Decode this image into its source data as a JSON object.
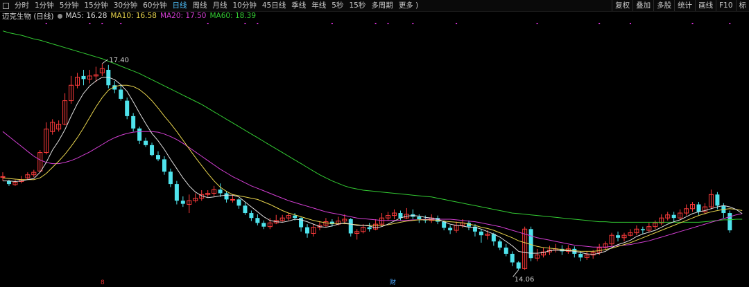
{
  "toolbar": {
    "periods": [
      "分时",
      "1分钟",
      "5分钟",
      "15分钟",
      "30分钟",
      "60分钟",
      "日线",
      "周线",
      "月线",
      "10分钟",
      "45日线",
      "季线",
      "年线",
      "5秒",
      "15秒",
      "多周期",
      "更多 )"
    ],
    "active_period": "日线",
    "right_items": [
      "复权",
      "叠加",
      "多股",
      "统计",
      "画线",
      "F10",
      "标"
    ]
  },
  "stock": {
    "name": "迈克生物 (日线)"
  },
  "ma_legend": [
    {
      "label": "MA5: 16.28",
      "color": "#e0e0e0"
    },
    {
      "label": "MA10: 16.58",
      "color": "#e8d44d"
    },
    {
      "label": "MA20: 17.50",
      "color": "#d43fd4"
    },
    {
      "label": "MA60: 18.39",
      "color": "#33cc33"
    }
  ],
  "annotations": {
    "high": "17.40",
    "low": "14.06"
  },
  "markers": {
    "bottom_left": "8",
    "bottom_mid": "财"
  },
  "chart_data": {
    "type": "candlestick",
    "colors": {
      "up": "#ff3b3b",
      "down": "#4fe3ec",
      "ma5": "#e0e0e0",
      "ma10": "#e8d44d",
      "ma20": "#d43fd4",
      "ma60": "#33cc33"
    },
    "candles": [
      [
        15.56,
        15.57,
        15.64,
        15.5
      ],
      [
        15.5,
        15.45,
        15.52,
        15.42
      ],
      [
        15.44,
        15.48,
        15.52,
        15.42
      ],
      [
        15.49,
        15.52,
        15.58,
        15.46
      ],
      [
        15.55,
        15.6,
        15.64,
        15.52
      ],
      [
        15.6,
        15.64,
        15.68,
        15.56
      ],
      [
        15.66,
        15.96,
        16.0,
        15.64
      ],
      [
        15.96,
        16.34,
        16.45,
        15.93
      ],
      [
        16.3,
        16.45,
        16.5,
        16.25
      ],
      [
        16.34,
        16.42,
        16.48,
        16.3
      ],
      [
        16.42,
        16.8,
        16.92,
        16.4
      ],
      [
        16.8,
        17.05,
        17.2,
        16.75
      ],
      [
        17.05,
        17.18,
        17.25,
        17.0
      ],
      [
        17.2,
        17.15,
        17.3,
        17.05
      ],
      [
        17.15,
        17.2,
        17.3,
        17.08
      ],
      [
        17.2,
        17.22,
        17.35,
        17.1
      ],
      [
        17.25,
        17.32,
        17.4,
        17.2
      ],
      [
        17.3,
        17.05,
        17.38,
        17.0
      ],
      [
        17.05,
        16.98,
        17.12,
        16.92
      ],
      [
        16.98,
        16.83,
        17.05,
        16.8
      ],
      [
        16.8,
        16.55,
        16.85,
        16.5
      ],
      [
        16.55,
        16.35,
        16.6,
        16.3
      ],
      [
        16.35,
        16.15,
        16.38,
        16.1
      ],
      [
        16.15,
        16.08,
        16.2,
        16.05
      ],
      [
        16.08,
        15.92,
        16.12,
        15.9
      ],
      [
        15.92,
        15.85,
        15.98,
        15.82
      ],
      [
        15.85,
        15.65,
        15.9,
        15.6
      ],
      [
        15.65,
        15.45,
        15.7,
        15.4
      ],
      [
        15.45,
        15.18,
        15.5,
        15.12
      ],
      [
        15.18,
        15.13,
        15.25,
        15.08
      ],
      [
        15.12,
        15.18,
        15.28,
        14.98
      ],
      [
        15.18,
        15.22,
        15.3,
        15.15
      ],
      [
        15.22,
        15.28,
        15.35,
        15.18
      ],
      [
        15.28,
        15.3,
        15.35,
        15.24
      ],
      [
        15.3,
        15.36,
        15.42,
        15.25
      ],
      [
        15.36,
        15.3,
        15.46,
        15.24
      ],
      [
        15.3,
        15.2,
        15.34,
        15.15
      ],
      [
        15.2,
        15.2,
        15.28,
        15.15
      ],
      [
        15.2,
        15.1,
        15.22,
        15.05
      ],
      [
        15.1,
        14.98,
        15.15,
        14.95
      ],
      [
        14.98,
        14.9,
        15.02,
        14.85
      ],
      [
        14.9,
        14.82,
        14.96,
        14.78
      ],
      [
        14.82,
        14.76,
        14.86,
        14.72
      ],
      [
        14.76,
        14.82,
        14.9,
        14.72
      ],
      [
        14.82,
        14.86,
        14.95,
        14.8
      ],
      [
        14.86,
        14.9,
        14.95,
        14.84
      ],
      [
        14.9,
        14.94,
        14.98,
        14.86
      ],
      [
        14.94,
        14.9,
        14.98,
        14.86
      ],
      [
        14.9,
        14.75,
        14.92,
        14.68
      ],
      [
        14.75,
        14.65,
        14.8,
        14.58
      ],
      [
        14.65,
        14.75,
        14.8,
        14.6
      ],
      [
        14.75,
        14.78,
        14.85,
        14.7
      ],
      [
        14.78,
        14.84,
        14.9,
        14.75
      ],
      [
        14.84,
        14.8,
        14.88,
        14.76
      ],
      [
        14.8,
        14.85,
        14.92,
        14.78
      ],
      [
        14.85,
        14.88,
        14.96,
        14.8
      ],
      [
        14.88,
        14.65,
        14.9,
        14.6
      ],
      [
        14.65,
        14.68,
        14.72,
        14.55
      ],
      [
        14.68,
        14.75,
        14.8,
        14.65
      ],
      [
        14.75,
        14.72,
        14.82,
        14.68
      ],
      [
        14.72,
        14.8,
        14.88,
        14.7
      ],
      [
        14.8,
        14.9,
        14.98,
        14.76
      ],
      [
        14.9,
        14.94,
        15.0,
        14.85
      ],
      [
        14.94,
        14.98,
        15.04,
        14.88
      ],
      [
        14.98,
        14.9,
        15.02,
        14.86
      ],
      [
        14.9,
        14.96,
        15.06,
        14.88
      ],
      [
        14.96,
        14.92,
        15.04,
        14.88
      ],
      [
        14.92,
        14.88,
        14.96,
        14.82
      ],
      [
        14.88,
        14.86,
        14.94,
        14.82
      ],
      [
        14.86,
        14.9,
        14.96,
        14.82
      ],
      [
        14.9,
        14.84,
        14.94,
        14.8
      ],
      [
        14.84,
        14.74,
        14.86,
        14.7
      ],
      [
        14.74,
        14.7,
        14.78,
        14.64
      ],
      [
        14.7,
        14.78,
        14.84,
        14.66
      ],
      [
        14.78,
        14.82,
        14.88,
        14.74
      ],
      [
        14.82,
        14.76,
        14.86,
        14.7
      ],
      [
        14.76,
        14.68,
        14.8,
        14.6
      ],
      [
        14.68,
        14.62,
        14.72,
        14.5
      ],
      [
        14.62,
        14.64,
        14.7,
        14.55
      ],
      [
        14.64,
        14.52,
        14.66,
        14.45
      ],
      [
        14.52,
        14.42,
        14.55,
        14.38
      ],
      [
        14.42,
        14.32,
        14.48,
        14.28
      ],
      [
        14.32,
        14.18,
        14.36,
        14.12
      ],
      [
        14.18,
        14.08,
        14.2,
        14.06
      ],
      [
        14.08,
        14.72,
        14.76,
        14.06
      ],
      [
        14.72,
        14.25,
        14.76,
        14.2
      ],
      [
        14.25,
        14.3,
        14.4,
        14.2
      ],
      [
        14.3,
        14.35,
        14.42,
        14.26
      ],
      [
        14.35,
        14.38,
        14.45,
        14.3
      ],
      [
        14.38,
        14.4,
        14.48,
        14.34
      ],
      [
        14.4,
        14.36,
        14.46,
        14.3
      ],
      [
        14.36,
        14.4,
        14.46,
        14.32
      ],
      [
        14.4,
        14.32,
        14.44,
        14.26
      ],
      [
        14.32,
        14.26,
        14.36,
        14.2
      ],
      [
        14.26,
        14.3,
        14.36,
        14.22
      ],
      [
        14.3,
        14.34,
        14.38,
        14.24
      ],
      [
        14.34,
        14.42,
        14.48,
        14.3
      ],
      [
        14.42,
        14.48,
        14.52,
        14.38
      ],
      [
        14.48,
        14.62,
        14.66,
        14.44
      ],
      [
        14.62,
        14.58,
        14.68,
        14.52
      ],
      [
        14.58,
        14.62,
        14.66,
        14.52
      ],
      [
        14.62,
        14.66,
        14.72,
        14.6
      ],
      [
        14.66,
        14.72,
        14.78,
        14.62
      ],
      [
        14.72,
        14.7,
        14.76,
        14.64
      ],
      [
        14.7,
        14.76,
        14.82,
        14.66
      ],
      [
        14.76,
        14.82,
        14.86,
        14.72
      ],
      [
        14.82,
        14.9,
        14.96,
        14.78
      ],
      [
        14.9,
        14.95,
        15.0,
        14.86
      ],
      [
        14.95,
        14.9,
        15.0,
        14.84
      ],
      [
        14.9,
        14.98,
        15.04,
        14.88
      ],
      [
        14.98,
        15.05,
        15.12,
        14.94
      ],
      [
        15.05,
        15.12,
        15.16,
        15.0
      ],
      [
        15.12,
        15.0,
        15.16,
        14.95
      ],
      [
        15.0,
        15.08,
        15.14,
        14.96
      ],
      [
        15.08,
        15.28,
        15.36,
        15.04
      ],
      [
        15.28,
        15.1,
        15.32,
        15.04
      ],
      [
        15.1,
        14.98,
        15.14,
        14.9
      ],
      [
        14.98,
        14.7,
        15.02,
        14.66
      ]
    ],
    "ma5": [
      15.5,
      15.5,
      15.49,
      15.5,
      15.52,
      15.54,
      15.64,
      15.8,
      16.0,
      16.15,
      16.33,
      16.55,
      16.75,
      16.92,
      17.04,
      17.12,
      17.18,
      17.18,
      17.14,
      17.06,
      16.95,
      16.78,
      16.6,
      16.43,
      16.27,
      16.15,
      16.01,
      15.85,
      15.7,
      15.55,
      15.42,
      15.32,
      15.26,
      15.23,
      15.24,
      15.26,
      15.27,
      15.27,
      15.24,
      15.16,
      15.08,
      15.0,
      14.92,
      14.86,
      14.84,
      14.83,
      14.85,
      14.88,
      14.87,
      14.84,
      14.8,
      14.76,
      14.75,
      14.77,
      14.8,
      14.82,
      14.8,
      14.78,
      14.78,
      14.77,
      14.74,
      14.76,
      14.8,
      14.85,
      14.9,
      14.93,
      14.94,
      14.93,
      14.91,
      14.9,
      14.88,
      14.84,
      14.8,
      14.78,
      14.77,
      14.75,
      14.75,
      14.72,
      14.68,
      14.64,
      14.59,
      14.52,
      14.45,
      14.36,
      14.34,
      14.33,
      14.33,
      14.34,
      14.37,
      14.38,
      14.37,
      14.37,
      14.36,
      14.34,
      14.32,
      14.31,
      14.33,
      14.36,
      14.42,
      14.47,
      14.5,
      14.54,
      14.6,
      14.64,
      14.67,
      14.7,
      14.75,
      14.8,
      14.84,
      14.87,
      14.92,
      14.97,
      15.0,
      15.02,
      15.05,
      15.08,
      15.1,
      15.08,
      15.04,
      14.97
    ],
    "ma10": [
      15.55,
      15.54,
      15.53,
      15.52,
      15.52,
      15.52,
      15.55,
      15.62,
      15.72,
      15.82,
      15.93,
      16.06,
      16.2,
      16.36,
      16.53,
      16.7,
      16.85,
      16.97,
      17.03,
      17.05,
      17.05,
      17.03,
      16.98,
      16.9,
      16.8,
      16.68,
      16.55,
      16.43,
      16.3,
      16.16,
      16.02,
      15.88,
      15.75,
      15.62,
      15.5,
      15.4,
      15.33,
      15.28,
      15.26,
      15.24,
      15.22,
      15.2,
      15.16,
      15.12,
      15.07,
      15.02,
      14.98,
      14.95,
      14.92,
      14.89,
      14.86,
      14.84,
      14.82,
      14.81,
      14.81,
      14.81,
      14.8,
      14.79,
      14.78,
      14.78,
      14.78,
      14.78,
      14.79,
      14.81,
      14.83,
      14.85,
      14.86,
      14.87,
      14.87,
      14.87,
      14.86,
      14.85,
      14.84,
      14.83,
      14.82,
      14.8,
      14.78,
      14.75,
      14.73,
      14.7,
      14.66,
      14.62,
      14.58,
      14.53,
      14.5,
      14.47,
      14.44,
      14.42,
      14.41,
      14.4,
      14.39,
      14.38,
      14.37,
      14.36,
      14.36,
      14.36,
      14.37,
      14.39,
      14.41,
      14.44,
      14.47,
      14.5,
      14.54,
      14.58,
      14.62,
      14.66,
      14.7,
      14.74,
      14.78,
      14.82,
      14.86,
      14.9,
      14.94,
      14.97,
      15.0,
      15.02,
      15.04,
      15.05,
      15.04,
      15.02
    ],
    "ma20": [
      16.3,
      16.22,
      16.14,
      16.06,
      15.98,
      15.9,
      15.84,
      15.8,
      15.78,
      15.78,
      15.8,
      15.83,
      15.87,
      15.92,
      15.97,
      16.03,
      16.09,
      16.15,
      16.2,
      16.24,
      16.27,
      16.29,
      16.3,
      16.3,
      16.3,
      16.29,
      16.26,
      16.22,
      16.17,
      16.11,
      16.04,
      15.97,
      15.9,
      15.83,
      15.76,
      15.69,
      15.63,
      15.57,
      15.52,
      15.47,
      15.42,
      15.38,
      15.34,
      15.3,
      15.26,
      15.22,
      15.18,
      15.15,
      15.12,
      15.09,
      15.06,
      15.03,
      15.0,
      14.98,
      14.96,
      14.94,
      14.92,
      14.9,
      14.89,
      14.88,
      14.87,
      14.86,
      14.86,
      14.86,
      14.86,
      14.86,
      14.87,
      14.87,
      14.88,
      14.88,
      14.88,
      14.88,
      14.88,
      14.87,
      14.86,
      14.85,
      14.84,
      14.82,
      14.8,
      14.78,
      14.76,
      14.73,
      14.7,
      14.67,
      14.64,
      14.61,
      14.58,
      14.56,
      14.54,
      14.52,
      14.5,
      14.48,
      14.46,
      14.45,
      14.44,
      14.43,
      14.43,
      14.43,
      14.44,
      14.45,
      14.46,
      14.47,
      14.49,
      14.51,
      14.53,
      14.56,
      14.59,
      14.62,
      14.65,
      14.68,
      14.71,
      14.74,
      14.77,
      14.8,
      14.83,
      14.86,
      14.89,
      14.92,
      14.95,
      14.97
    ],
    "ma60": [
      17.93,
      17.9,
      17.88,
      17.86,
      17.83,
      17.8,
      17.78,
      17.75,
      17.72,
      17.69,
      17.66,
      17.63,
      17.6,
      17.57,
      17.54,
      17.51,
      17.48,
      17.44,
      17.4,
      17.36,
      17.32,
      17.28,
      17.24,
      17.19,
      17.14,
      17.09,
      17.04,
      16.99,
      16.94,
      16.89,
      16.84,
      16.79,
      16.74,
      16.68,
      16.62,
      16.56,
      16.5,
      16.44,
      16.38,
      16.32,
      16.26,
      16.2,
      16.14,
      16.08,
      16.02,
      15.96,
      15.9,
      15.84,
      15.78,
      15.72,
      15.66,
      15.6,
      15.55,
      15.5,
      15.46,
      15.42,
      15.39,
      15.37,
      15.35,
      15.34,
      15.33,
      15.32,
      15.31,
      15.3,
      15.29,
      15.28,
      15.27,
      15.26,
      15.25,
      15.24,
      15.22,
      15.2,
      15.18,
      15.16,
      15.14,
      15.12,
      15.1,
      15.08,
      15.06,
      15.04,
      15.02,
      15.0,
      14.98,
      14.97,
      14.96,
      14.95,
      14.94,
      14.93,
      14.92,
      14.91,
      14.9,
      14.89,
      14.88,
      14.87,
      14.86,
      14.85,
      14.84,
      14.84,
      14.83,
      14.83,
      14.83,
      14.83,
      14.83,
      14.83,
      14.83,
      14.83,
      14.83,
      14.83,
      14.83,
      14.83,
      14.83,
      14.83,
      14.83,
      14.84,
      14.85,
      14.86,
      14.87,
      14.87,
      14.88,
      14.88
    ],
    "ylim": [
      13.95,
      18.05
    ]
  }
}
